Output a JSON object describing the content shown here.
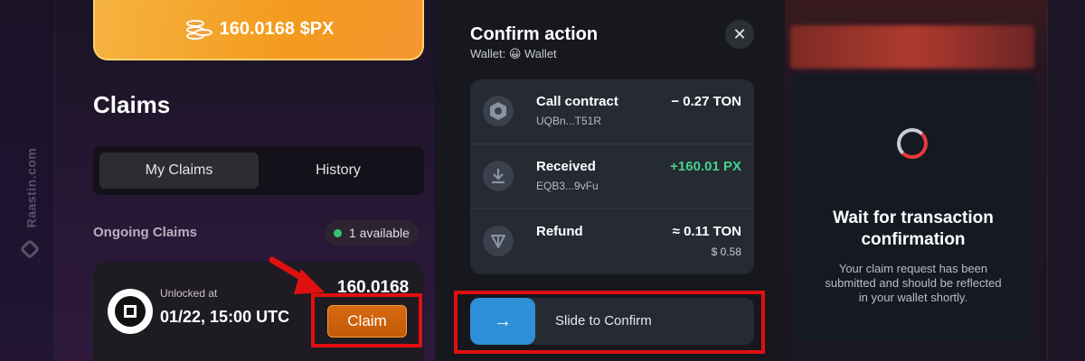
{
  "watermark": {
    "text": "Raastin.com"
  },
  "balance_card": {
    "amount": "160.0168 $PX",
    "icon": "coins-icon"
  },
  "claims": {
    "title": "Claims",
    "tabs": [
      {
        "label": "My Claims",
        "active": true
      },
      {
        "label": "History",
        "active": false
      }
    ],
    "ongoing_label": "Ongoing Claims",
    "available_badge": "1 available",
    "card": {
      "unlock_label": "Unlocked at",
      "unlock_date": "01/22, 15:00 UTC",
      "amount": "160.0168",
      "claim_button": "Claim"
    }
  },
  "modal": {
    "title": "Confirm action",
    "wallet_line": "Wallet: 😀 Wallet",
    "close_icon": "close-icon",
    "actions": [
      {
        "title": "Call contract",
        "sub": "UQBn...T51R",
        "amount": "− 0.27 TON",
        "fiat": "",
        "icon": "hexagon-nut-icon"
      },
      {
        "title": "Received",
        "sub": "EQB3...9vFu",
        "amount": "+160.01 PX",
        "fiat": "",
        "icon": "download-icon"
      },
      {
        "title": "Refund",
        "sub": "",
        "amount": "≈ 0.11 TON",
        "fiat": "$ 0.58",
        "icon": "ton-icon"
      }
    ],
    "slider_label": "Slide to Confirm"
  },
  "wait_panel": {
    "title": "Wait for transaction confirmation",
    "description": "Your claim request has been submitted and should be reflected in your wallet shortly."
  },
  "colors": {
    "accent_orange": "#f39a1e",
    "slider_blue": "#2e90d6",
    "highlight_red": "#e01010",
    "positive_green": "#45d28b"
  }
}
